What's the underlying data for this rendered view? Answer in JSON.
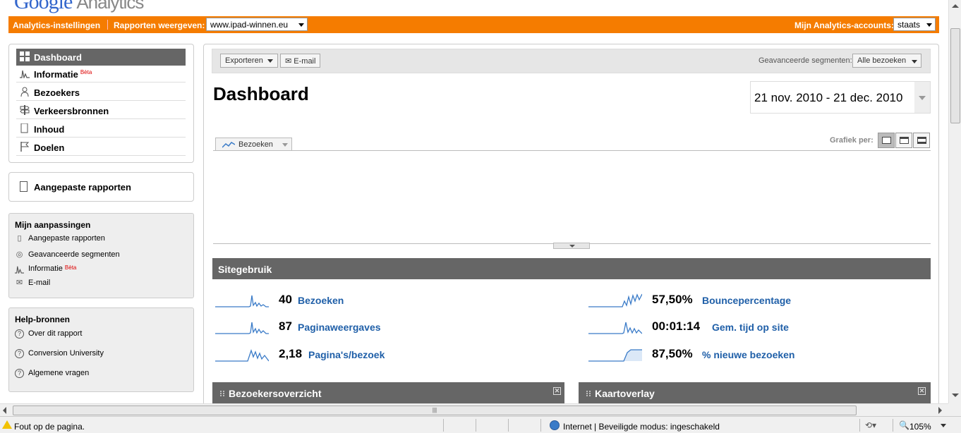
{
  "header": {
    "logo_text": "Google",
    "logo_suffix": "Analytics"
  },
  "orange_bar": {
    "settings": "Analytics-instellingen",
    "reports_label": "Rapporten weergeven:",
    "site_value": "www.ipad-winnen.eu",
    "accounts_label": "Mijn Analytics-accounts:",
    "account_value": "staats",
    "color": "#f57c00"
  },
  "nav": {
    "items": [
      {
        "label": "Dashboard",
        "icon": "grid-icon",
        "active": true
      },
      {
        "label": "Informatie",
        "icon": "spark-icon",
        "beta": "Bèta"
      },
      {
        "label": "Bezoekers",
        "icon": "person-icon"
      },
      {
        "label": "Verkeersbronnen",
        "icon": "signpost-icon"
      },
      {
        "label": "Inhoud",
        "icon": "page-icon"
      },
      {
        "label": "Doelen",
        "icon": "flag-icon"
      }
    ],
    "custom_reports": "Aangepaste rapporten"
  },
  "customizations": {
    "heading": "Mijn aanpassingen",
    "items": [
      {
        "label": "Aangepaste rapporten",
        "icon": "report-icon"
      },
      {
        "label": "Geavanceerde segmenten",
        "icon": "segment-icon"
      },
      {
        "label": "Informatie",
        "icon": "spark-icon",
        "beta": "Bèta"
      },
      {
        "label": "E-mail",
        "icon": "envelope-icon"
      }
    ]
  },
  "help": {
    "heading": "Help-bronnen",
    "items": [
      {
        "label": "Over dit rapport",
        "icon": "help-icon"
      },
      {
        "label": "Conversion University",
        "icon": "help-icon"
      },
      {
        "label": "Algemene vragen",
        "icon": "help-icon"
      }
    ]
  },
  "toolbar": {
    "export": "Exporteren",
    "email": "E-mail",
    "segments_label": "Geavanceerde segmenten:",
    "segments_value": "Alle bezoeken"
  },
  "dashboard": {
    "title": "Dashboard",
    "date_range": "21 nov. 2010 - 21 dec. 2010",
    "chart_tab": "Bezoeken",
    "graph_by": "Grafiek per:"
  },
  "site_usage": {
    "title": "Sitegebruik",
    "metrics": [
      {
        "value": "40",
        "label": "Bezoeken",
        "spark": "visits"
      },
      {
        "value": "87",
        "label": "Paginaweergaves",
        "spark": "pageviews"
      },
      {
        "value": "2,18",
        "label": "Pagina's/bezoek",
        "spark": "pagespervisit"
      },
      {
        "value": "57,50%",
        "label": "Bouncepercentage",
        "spark": "bounce"
      },
      {
        "value": "00:01:14",
        "label": "Gem. tijd op site",
        "spark": "time"
      },
      {
        "value": "87,50%",
        "label": "% nieuwe bezoeken",
        "spark": "newvisits"
      }
    ]
  },
  "panels": {
    "visitors_overview": "Bezoekersoverzicht",
    "map_overlay": "Kaartoverlay"
  },
  "statusbar": {
    "error": "Fout op de pagina.",
    "zone": "Internet | Beveiligde modus: ingeschakeld",
    "zoom": "105%"
  }
}
